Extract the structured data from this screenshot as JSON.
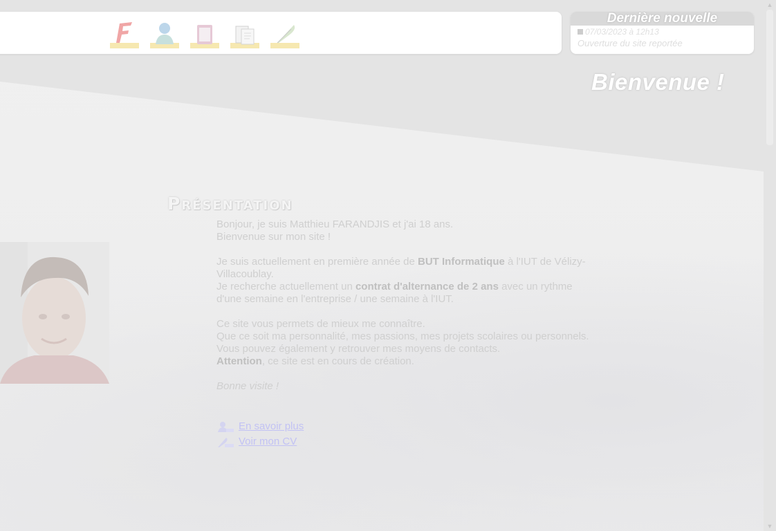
{
  "toolbar": {
    "icons": [
      {
        "name": "flash-f-icon"
      },
      {
        "name": "person-icon"
      },
      {
        "name": "book-icon"
      },
      {
        "name": "document-icon"
      },
      {
        "name": "feather-pen-icon"
      }
    ]
  },
  "news": {
    "title": "Dernière nouvelle",
    "date": "07/03/2023 à 12h13",
    "text": "Ouverture du site reportée"
  },
  "welcome": "Bienvenue !",
  "presentation": {
    "title": "Présentation",
    "line1": "Bonjour, je suis Matthieu FARANDJIS et j'ai 18 ans.",
    "line2": "Bienvenue sur mon site !",
    "line3a": "Je suis actuellement en première année de ",
    "line3b": "BUT Informatique",
    "line3c": " à l'IUT de Vélizy-Villacoublay.",
    "line4a": "Je recherche actuellement un ",
    "line4b": "contrat d'alternance de 2 ans",
    "line4c": " avec un rythme d'une semaine en l'entreprise / une semaine à l'IUT.",
    "line5": "Ce site vous permets de mieux me connaître.",
    "line6": "Que ce soit ma personnalité, mes passions, mes projets scolaires ou personnels.",
    "line7": "Vous pouvez également y retrouver mes moyens de contacts.",
    "line8a": "Attention",
    "line8b": ", ce site est en cours de création.",
    "line9": "Bonne visite !"
  },
  "links": {
    "more": "En savoir plus",
    "cv": "Voir mon CV"
  }
}
